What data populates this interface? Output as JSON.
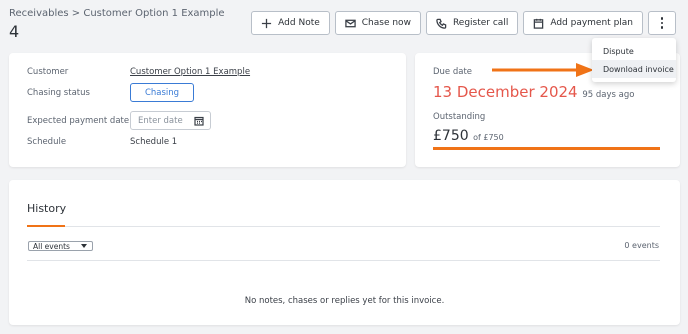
{
  "breadcrumb": "Receivables > Customer Option 1 Example",
  "page_title": "4",
  "toolbar": {
    "add_note": "Add Note",
    "chase_now": "Chase now",
    "register_call": "Register call",
    "add_payment_plan": "Add payment plan"
  },
  "dropdown": {
    "dispute": "Dispute",
    "download_invoice": "Download invoice"
  },
  "details": {
    "customer_label": "Customer",
    "customer_value": "Customer Option 1 Example",
    "chasing_status_label": "Chasing status",
    "chasing_status_value": "Chasing",
    "expected_date_label": "Expected payment date",
    "expected_date_placeholder": "Enter date",
    "schedule_label": "Schedule",
    "schedule_value": "Schedule 1"
  },
  "due": {
    "label": "Due date",
    "date": "13 December 2024",
    "ago": "95 days ago",
    "outstanding_label": "Outstanding",
    "amount": "£750",
    "of_total": "of £750",
    "outstanding_fraction": 1.0
  },
  "history": {
    "tab": "History",
    "filter": "All events",
    "count": "0 events",
    "empty": "No notes, chases or replies yet for this invoice."
  },
  "colors": {
    "accent_orange": "#f07317",
    "due_red": "#e5574b",
    "link_blue": "#3a7bd5"
  }
}
